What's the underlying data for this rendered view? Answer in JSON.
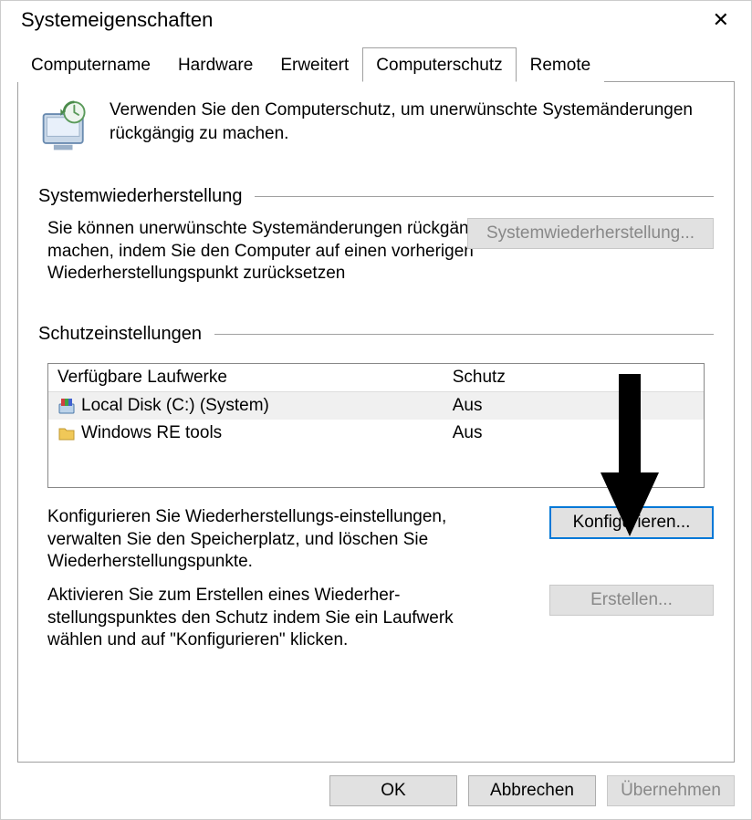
{
  "window": {
    "title": "Systemeigenschaften",
    "close_glyph": "✕"
  },
  "tabs": {
    "t0": "Computername",
    "t1": "Hardware",
    "t2": "Erweitert",
    "t3": "Computerschutz",
    "t4": "Remote"
  },
  "intro": "Verwenden Sie den Computerschutz, um unerwünschte Systemänderungen rückgängig zu machen.",
  "section_restore": {
    "title": "Systemwiederherstellung",
    "text": "Sie können unerwünschte Systemänderungen rückgängig machen, indem Sie den Computer auf einen vorherigen Wiederherstellungspunkt zurücksetzen",
    "button": "Systemwiederherstellung..."
  },
  "section_settings": {
    "title": "Schutzeinstellungen",
    "col_drive": "Verfügbare Laufwerke",
    "col_prot": "Schutz",
    "drives": [
      {
        "name": "Local Disk (C:) (System)",
        "protection": "Aus"
      },
      {
        "name": "Windows RE tools",
        "protection": "Aus"
      }
    ],
    "configure_text": "Konfigurieren Sie Wiederherstellungs-einstellungen, verwalten Sie den Speicherplatz, und löschen Sie Wiederherstellungspunkte.",
    "configure_button": "Konfigurieren...",
    "create_text": "Aktivieren Sie zum Erstellen eines Wiederher-stellungspunktes den Schutz indem Sie ein Laufwerk wählen und auf \"Konfigurieren\" klicken.",
    "create_button": "Erstellen..."
  },
  "buttons": {
    "ok": "OK",
    "cancel": "Abbrechen",
    "apply": "Übernehmen"
  }
}
